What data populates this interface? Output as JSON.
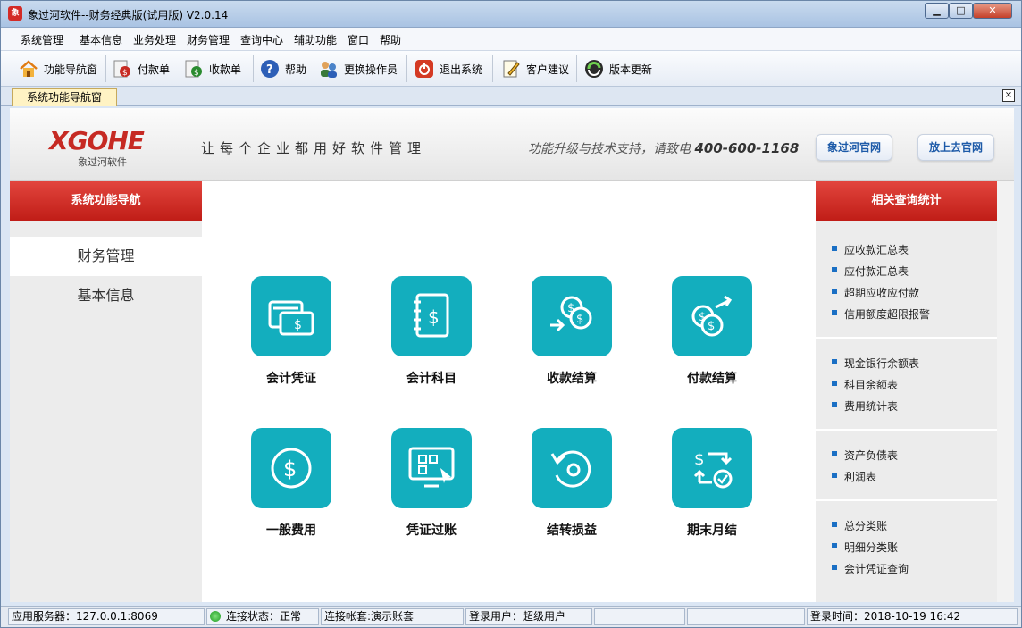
{
  "window": {
    "title": "象过河软件--财务经典版(试用版) V2.0.14",
    "app_icon": "象"
  },
  "menubar": [
    "系统管理",
    "基本信息",
    "业务处理",
    "财务管理",
    "查询中心",
    "辅助功能",
    "窗口",
    "帮助"
  ],
  "toolbar": [
    {
      "label": "功能导航窗",
      "icon": "home-icon"
    },
    {
      "label": "付款单",
      "icon": "pay-icon"
    },
    {
      "label": "收款单",
      "icon": "receive-icon"
    },
    {
      "label": "帮助",
      "icon": "help-icon"
    },
    {
      "label": "更换操作员",
      "icon": "users-icon"
    },
    {
      "label": "退出系统",
      "icon": "exit-icon"
    },
    {
      "label": "客户建议",
      "icon": "edit-icon"
    },
    {
      "label": "版本更新",
      "icon": "update-icon"
    }
  ],
  "tab": {
    "label": "系统功能导航窗",
    "close": "×"
  },
  "banner": {
    "logo": "XGOHE",
    "logo_sub": "象过河软件",
    "slogan": "让每个企业都用好软件管理",
    "support_text": "功能升级与技术支持，请致电",
    "support_phone": "400-600-1168",
    "btn_official": "象过河官网",
    "btn_fangshang": "放上去官网"
  },
  "left": {
    "header": "系统功能导航",
    "items": [
      "财务管理",
      "基本信息"
    ]
  },
  "tiles": [
    {
      "label": "会计凭证",
      "icon": "voucher-icon"
    },
    {
      "label": "会计科目",
      "icon": "ledger-book-icon"
    },
    {
      "label": "收款结算",
      "icon": "coins-in-icon"
    },
    {
      "label": "付款结算",
      "icon": "coins-out-icon"
    },
    {
      "label": "一般费用",
      "icon": "dollar-circle-icon"
    },
    {
      "label": "凭证过账",
      "icon": "screen-post-icon"
    },
    {
      "label": "结转损益",
      "icon": "cycle-icon"
    },
    {
      "label": "期末月结",
      "icon": "month-close-icon"
    }
  ],
  "right": {
    "header": "相关查询统计",
    "groups": [
      [
        "应收款汇总表",
        "应付款汇总表",
        "超期应收应付款",
        "信用额度超限报警"
      ],
      [
        "现金银行余额表",
        "科目余额表",
        "费用统计表"
      ],
      [
        "资产负债表",
        "利润表"
      ],
      [
        "总分类账",
        "明细分类账",
        "会计凭证查询"
      ]
    ]
  },
  "status": {
    "server": "应用服务器：127.0.0.1:8069",
    "connection": "连接状态：正常",
    "account": "连接帐套:演示账套",
    "user": "登录用户：超级用户",
    "login_time": "登录时间：2018-10-19 16:42"
  },
  "colors": {
    "accent": "#13aebe",
    "header_red": "#d22f28",
    "link_bullet": "#1a6fc4"
  }
}
